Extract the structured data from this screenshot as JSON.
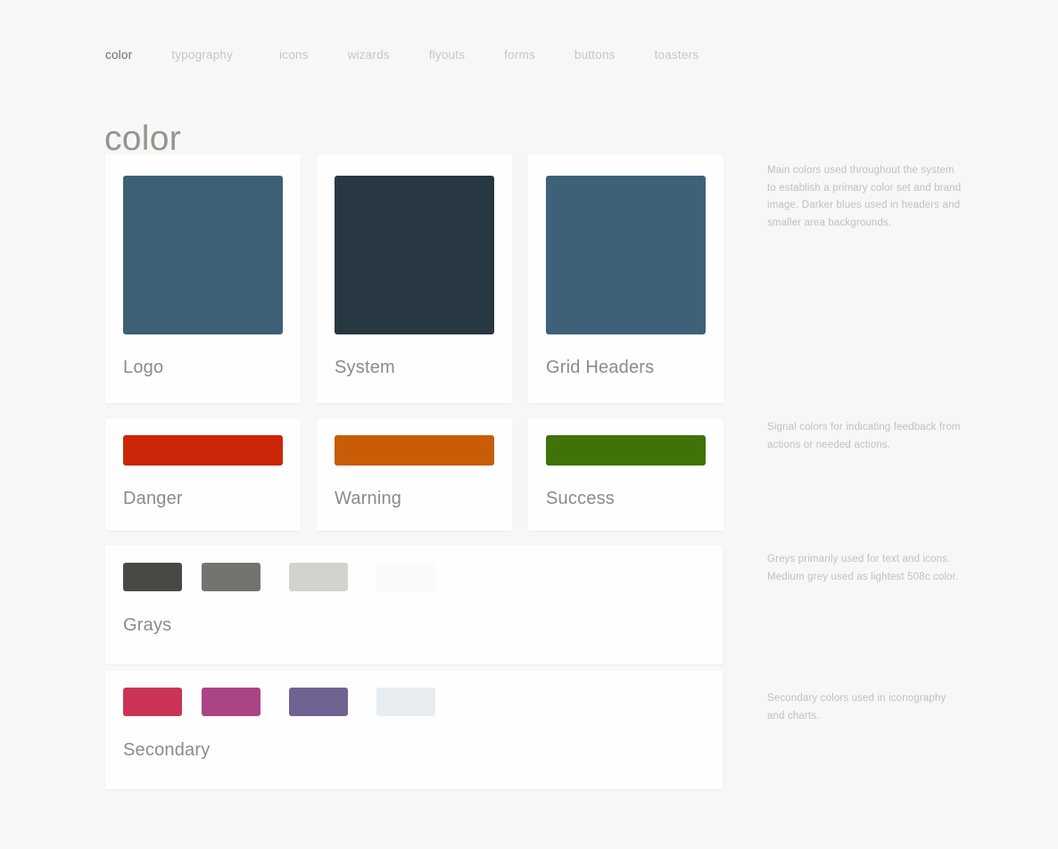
{
  "nav": {
    "items": [
      {
        "label": "color",
        "active": true
      },
      {
        "label": "typography",
        "active": false
      },
      {
        "label": "icons",
        "active": false
      },
      {
        "label": "wizards",
        "active": false
      },
      {
        "label": "flyouts",
        "active": false
      },
      {
        "label": "forms",
        "active": false
      },
      {
        "label": "buttons",
        "active": false
      },
      {
        "label": "toasters",
        "active": false
      }
    ]
  },
  "page": {
    "title": "color",
    "background": "#f7f7f6",
    "card_background": "#fefefe"
  },
  "sections": [
    {
      "name": "primary",
      "description": "Main colors used throughout the system to establish a primary color set and brand image. Darker blues used in headers and smaller area backgrounds.",
      "cards": [
        {
          "label": "Logo",
          "color": "#3d6077"
        },
        {
          "label": "System",
          "color": "#283843"
        },
        {
          "label": "Grid Headers",
          "color": "#3c6179"
        }
      ]
    },
    {
      "name": "signal",
      "description": "Signal colors for indicating feedback from actions or needed actions.",
      "cards": [
        {
          "label": "Danger",
          "color": "#cc2608"
        },
        {
          "label": "Warning",
          "color": "#c85c07"
        },
        {
          "label": "Success",
          "color": "#3f7209"
        }
      ]
    },
    {
      "name": "grays",
      "description": "Greys primarily used for text and icons. Medium grey used as lightest 508c color.",
      "label": "Grays",
      "swatches": [
        {
          "color": "#4a4845"
        },
        {
          "color": "#757370"
        },
        {
          "color": "#d3d2cf"
        },
        {
          "color": "#fafaf9"
        }
      ]
    },
    {
      "name": "secondary",
      "description": "Secondary colors used in iconography and charts.",
      "label": "Secondary",
      "swatches": [
        {
          "color": "#cc3355"
        },
        {
          "color": "#ab4484"
        },
        {
          "color": "#6f6392"
        },
        {
          "color": "#e7edf0"
        }
      ]
    }
  ]
}
